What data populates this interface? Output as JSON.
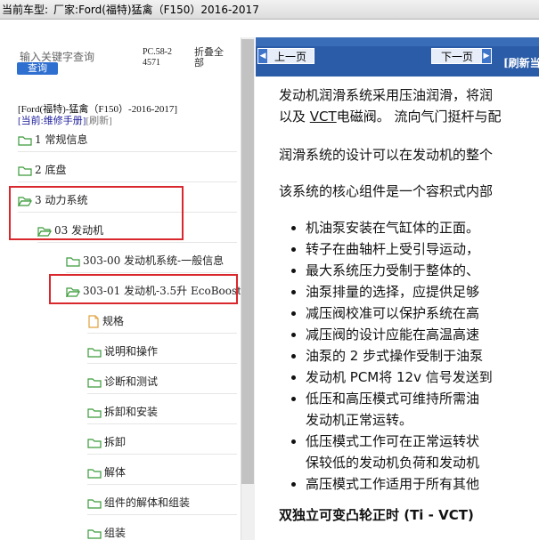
{
  "titlebar": {
    "label": "当前车型:",
    "value": "厂家:Ford(福特)猛禽（F150）2016-2017"
  },
  "left": {
    "search_placeholder": "输入关键字查询",
    "query_button": "查询",
    "pc_code": "PC.58-24571",
    "collapse_all": "折叠全部",
    "vehicle": "[Ford(福特)-猛禽（F150）-2016-2017]",
    "current_label": "[当前:",
    "current_value": "维修手册",
    "current_close": "]",
    "refresh": "[刷新]",
    "tree": [
      {
        "label": "1 常规信息",
        "icon": "folder-icon"
      },
      {
        "label": "2 底盘",
        "icon": "folder-icon"
      },
      {
        "label": "3 动力系统",
        "icon": "folder-open-icon"
      },
      {
        "label": "03 发动机",
        "icon": "folder-open-icon"
      },
      {
        "label": "303-00 发动机系统-一般信息",
        "icon": "folder-icon"
      },
      {
        "label": "303-01 发动机-3.5升 EcoBoost",
        "icon": "folder-open-icon"
      },
      {
        "label": "规格",
        "icon": "document-icon"
      },
      {
        "label": "说明和操作",
        "icon": "folder-icon"
      },
      {
        "label": "诊断和测试",
        "icon": "folder-icon"
      },
      {
        "label": "拆卸和安装",
        "icon": "folder-icon"
      },
      {
        "label": "拆卸",
        "icon": "folder-icon"
      },
      {
        "label": "解体",
        "icon": "folder-icon"
      },
      {
        "label": "组件的解体和组装",
        "icon": "folder-icon"
      },
      {
        "label": "组装",
        "icon": "folder-icon"
      }
    ]
  },
  "right": {
    "prev_button": "上一页",
    "next_button": "下一页",
    "refresh": "[刷新当",
    "para1_line1": "发动机润滑系统采用压油润滑，将润",
    "para1_line2_pre": "以及 ",
    "para1_line2_link": "VCT",
    "para1_line2_post": "电磁阀。 流向气门挺杆与配",
    "para2": "润滑系统的设计可以在发动机的整个",
    "para3": "该系统的核心组件是一个容积式内部",
    "bullets": [
      "机油泵安装在气缸体的正面。",
      "转子在曲轴杆上受引导运动，",
      "最大系统压力受制于整体的、",
      "油泵排量的选择，应提供足够",
      "减压阀校准可以保护系统在高",
      "减压阀的设计应能在高温高速",
      "油泵的 2 步式操作受制于油泵",
      "发动机 PCM将 12v 信号发送到",
      "低压和高压模式可维持所需油",
      "发动机正常运转。",
      "低压模式工作可在正常运转状",
      "保较低的发动机负荷和发动机",
      "高压模式工作适用于所有其他"
    ],
    "heading": "双独立可变凸轮正时 (Ti - VCT)"
  }
}
